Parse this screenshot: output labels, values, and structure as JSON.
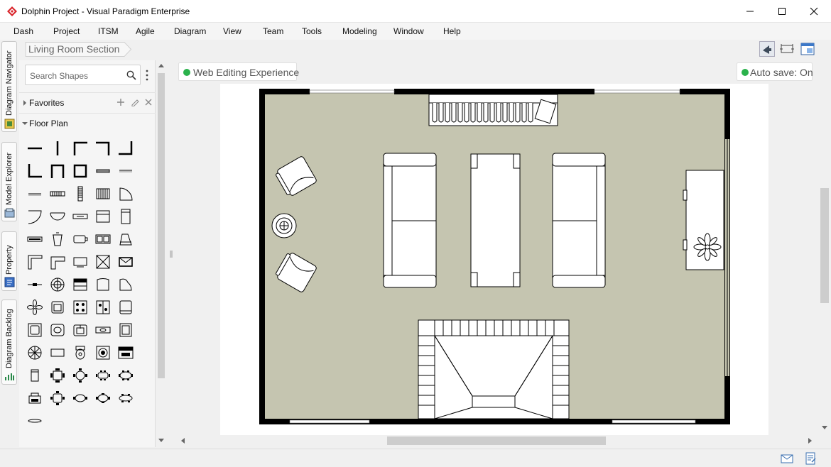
{
  "window": {
    "title": "Dolphin Project - Visual Paradigm Enterprise",
    "app_icon": "visual-paradigm-logo",
    "controls": [
      "minimize-icon",
      "maximize-icon",
      "close-icon"
    ]
  },
  "menu": {
    "items": [
      "Dash",
      "Project",
      "ITSM",
      "Agile",
      "Diagram",
      "View",
      "Team",
      "Tools",
      "Modeling",
      "Window",
      "Help"
    ]
  },
  "left_tabs": [
    {
      "label": "Diagram Navigator",
      "icon": "diagram-navigator-icon"
    },
    {
      "label": "Model Explorer",
      "icon": "model-explorer-icon"
    },
    {
      "label": "Property",
      "icon": "property-icon"
    },
    {
      "label": "Diagram Backlog",
      "icon": "backlog-icon"
    }
  ],
  "breadcrumb": {
    "label": "Living Room Section"
  },
  "toolbar_icons": [
    "announcement-icon",
    "fit-size-icon",
    "window-layout-icon"
  ],
  "palette": {
    "search_placeholder": "Search Shapes",
    "favorites": {
      "label": "Favorites",
      "expanded": false
    },
    "floor_plan": {
      "label": "Floor Plan",
      "expanded": true
    }
  },
  "chips": {
    "web_editing": "Web Editing Experience",
    "autosave": "Auto save: On",
    "status_color": "#2bb24c"
  },
  "canvas": {
    "floor_color": "#c5c5b0",
    "wall_color": "#000000"
  },
  "statusbar_icons": [
    "mail-icon",
    "notes-icon"
  ]
}
